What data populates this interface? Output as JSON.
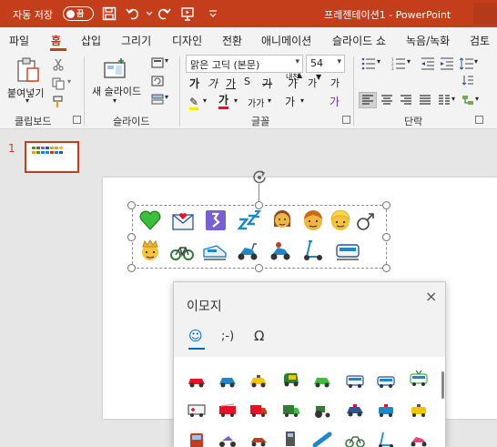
{
  "titlebar": {
    "autosave_label": "자동 저장",
    "autosave_state": "끔",
    "doc_title": "프레젠테이션1  -  PowerPoint"
  },
  "tabs": [
    {
      "label": "파일"
    },
    {
      "label": "홈"
    },
    {
      "label": "삽입"
    },
    {
      "label": "그리기"
    },
    {
      "label": "디자인"
    },
    {
      "label": "전환"
    },
    {
      "label": "애니메이션"
    },
    {
      "label": "슬라이드 쇼"
    },
    {
      "label": "녹음/녹화"
    },
    {
      "label": "검토"
    }
  ],
  "ribbon": {
    "paste_label": "붙여넣기",
    "new_slide_label": "새 슬라이드",
    "font_name": "맑은 고딕 (본문)",
    "font_size": "54",
    "groups": {
      "clipboard": "클립보드",
      "slides": "슬라이드",
      "font": "글꼴",
      "paragraph": "단락"
    },
    "font_grow": "가",
    "font_shrink": "가",
    "clear_format": "가",
    "char_spacing": "가가",
    "change_case": "가",
    "phonetic": "내천",
    "bold": "가",
    "italic": "가",
    "underline": "가",
    "strike": "가"
  },
  "thumbnails": {
    "slide_number": "1"
  },
  "emoji_panel": {
    "title": "이모지",
    "tabs": [
      "☺",
      ";-)",
      "Ω"
    ],
    "close_icon": "×"
  },
  "colors": {
    "brand": "#c43e1c",
    "highlight": "#ffe600",
    "font_color": "#e81123"
  }
}
